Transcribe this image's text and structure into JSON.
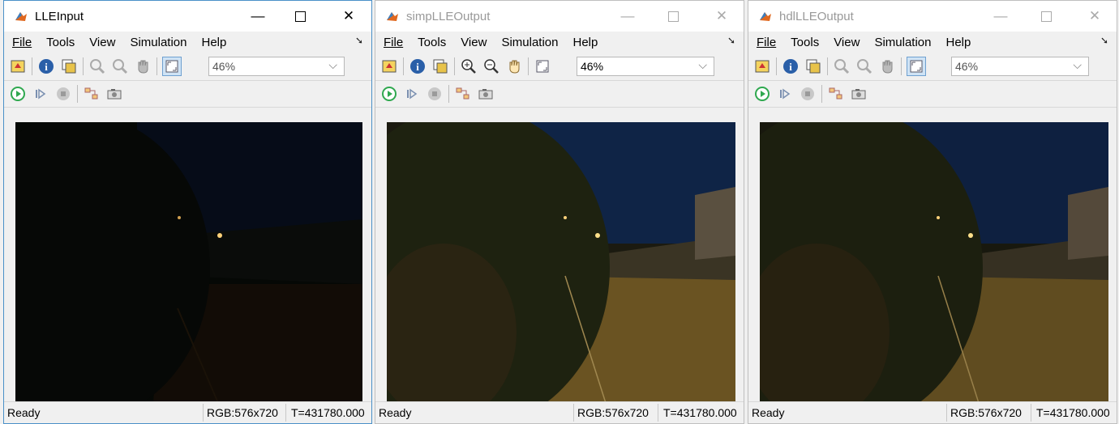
{
  "windows": [
    {
      "title": "LLEInput",
      "state": "active",
      "menu": {
        "file": "File",
        "tools": "Tools",
        "view": "View",
        "simulation": "Simulation",
        "help": "Help"
      },
      "zoom": "46%",
      "image_brightness": "dark",
      "status": {
        "ready": "Ready",
        "format": "RGB:576x720",
        "time": "T=431780.000"
      }
    },
    {
      "title": "simpLLEOutput",
      "state": "inactive",
      "menu": {
        "file": "File",
        "tools": "Tools",
        "view": "View",
        "simulation": "Simulation",
        "help": "Help"
      },
      "zoom": "46%",
      "image_brightness": "enhanced",
      "status": {
        "ready": "Ready",
        "format": "RGB:576x720",
        "time": "T=431780.000"
      }
    },
    {
      "title": "hdlLLEOutput",
      "state": "inactive",
      "menu": {
        "file": "File",
        "tools": "Tools",
        "view": "View",
        "simulation": "Simulation",
        "help": "Help"
      },
      "zoom": "46%",
      "image_brightness": "enhanced",
      "status": {
        "ready": "Ready",
        "format": "RGB:576x720",
        "time": "T=431780.000"
      }
    }
  ],
  "icons": {
    "app": "matlab-logo-icon",
    "minimize": "minimize-icon",
    "maximize": "maximize-icon",
    "close": "close-icon",
    "simulink": "simulink-home-icon",
    "info": "info-icon",
    "export": "export-icon",
    "zoom_in": "zoom-in-icon",
    "zoom_out": "zoom-out-icon",
    "pan": "pan-hand-icon",
    "fit": "fit-to-view-icon",
    "run": "run-icon",
    "step": "step-forward-icon",
    "stop": "stop-icon",
    "highlight": "highlight-block-icon",
    "snapshot": "snapshot-camera-icon"
  },
  "colors": {
    "active_border": "#4a90c8",
    "run_green": "#2fa84f",
    "sky_dark": "#0b1530",
    "road_enhanced": "#6a5322"
  }
}
